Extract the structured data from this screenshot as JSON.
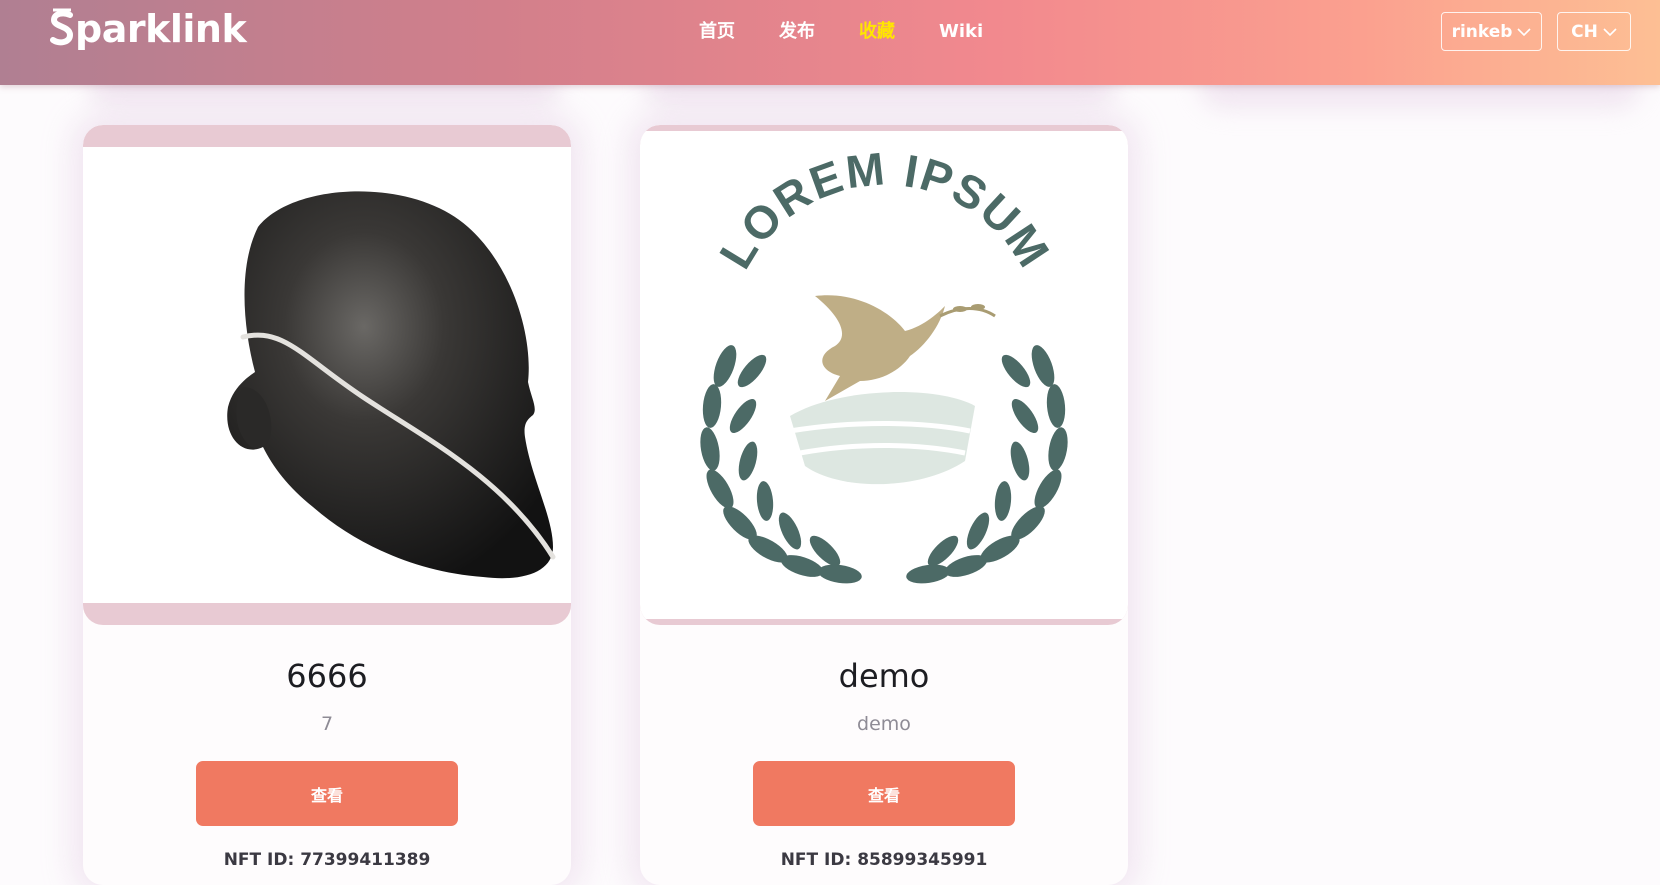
{
  "header": {
    "logo_text": "parklink",
    "logo_lettermark": "S",
    "nav": [
      {
        "label": "首页",
        "active": false
      },
      {
        "label": "发布",
        "active": false
      },
      {
        "label": "收藏",
        "active": true
      },
      {
        "label": "Wiki",
        "active": false
      }
    ],
    "network_select": "rinkeb",
    "language_select": "CH",
    "active_color": "#ffe600"
  },
  "cards": [
    {
      "image": "black-mannequin-head-icon",
      "title": "6666",
      "subtitle": "7",
      "button_label": "查看",
      "nft_id": "NFT ID: 77399411389"
    },
    {
      "image": "lorem-ipsum-dove-laurel-logo",
      "image_text": "LOREM IPSUM",
      "title": "demo",
      "subtitle": "demo",
      "button_label": "查看",
      "nft_id": "NFT ID: 85899345991"
    }
  ],
  "colors": {
    "button": "#f07961",
    "card_media_frame": "#e8cad3",
    "logo_green": "#4c6a66",
    "dove_gold": "#bfae86"
  }
}
